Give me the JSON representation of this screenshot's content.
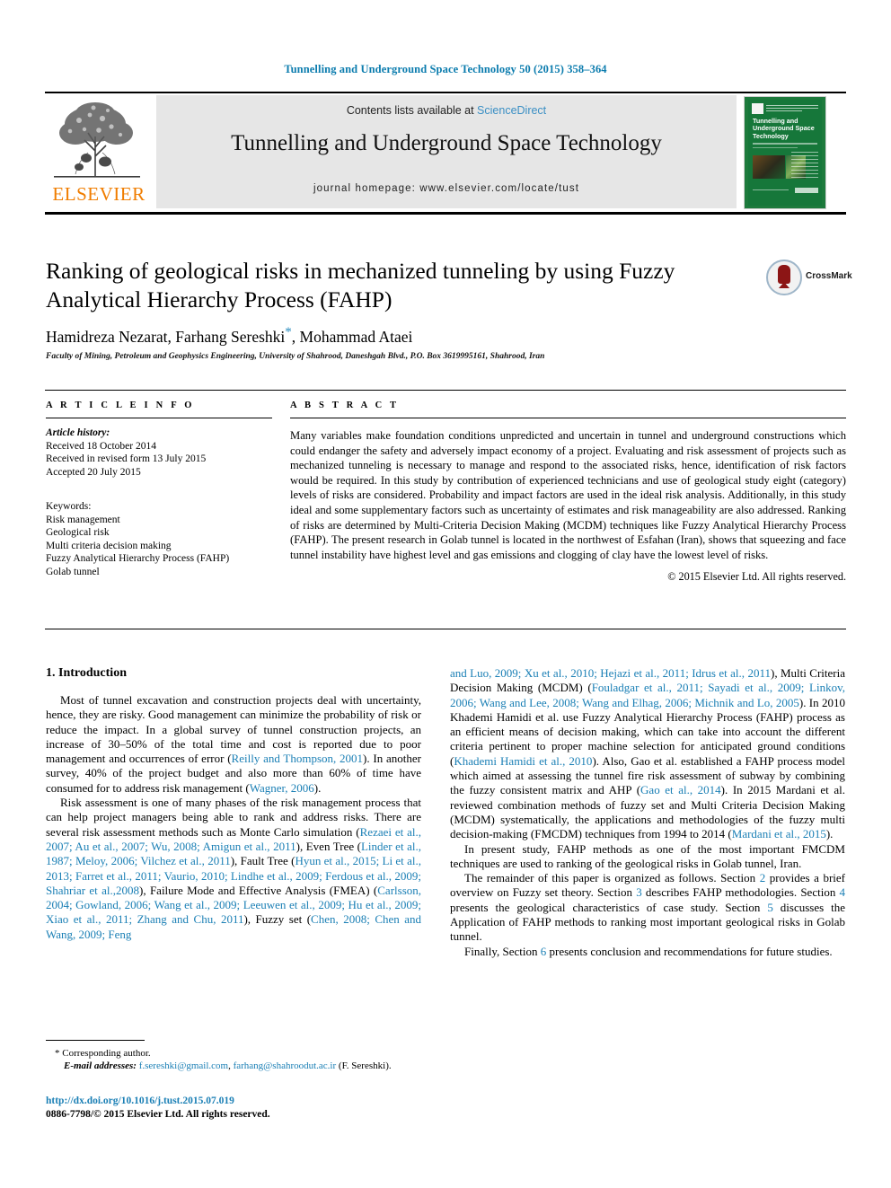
{
  "running_head": "Tunnelling and Underground Space Technology 50 (2015) 358–364",
  "masthead": {
    "contents_prefix": "Contents lists available at ",
    "sciencedirect": "ScienceDirect",
    "journal_title": "Tunnelling and Underground Space Technology",
    "homepage": "journal homepage: www.elsevier.com/locate/tust",
    "publisher_wordmark": "ELSEVIER",
    "cover": {
      "title": "Tunnelling and Underground Space Technology"
    }
  },
  "article": {
    "title": "Ranking of geological risks in mechanized tunneling by using Fuzzy Analytical Hierarchy Process (FAHP)",
    "authors_part1": "Hamidreza Nezarat, Farhang Sereshki",
    "corresponding_marker": "*",
    "authors_part2": ", Mohammad Ataei",
    "affiliation": "Faculty of Mining, Petroleum and Geophysics Engineering, University of Shahrood, Daneshgah Blvd., P.O. Box 3619995161, Shahrood, Iran",
    "crossmark_label": "CrossMark"
  },
  "article_info": {
    "heading": "A R T I C L E   I N F O",
    "history_label": "Article history:",
    "received": "Received 18 October 2014",
    "revised": "Received in revised form 13 July 2015",
    "accepted": "Accepted 20 July 2015",
    "keywords_label": "Keywords:",
    "keywords": [
      "Risk management",
      "Geological risk",
      "Multi criteria decision making",
      "Fuzzy Analytical Hierarchy Process (FAHP)",
      "Golab tunnel"
    ]
  },
  "abstract": {
    "heading": "A B S T R A C T",
    "text": "Many variables make foundation conditions unpredicted and uncertain in tunnel and underground constructions which could endanger the safety and adversely impact economy of a project. Evaluating and risk assessment of projects such as mechanized tunneling is necessary to manage and respond to the associated risks, hence, identification of risk factors would be required. In this study by contribution of experienced technicians and use of geological study eight (category) levels of risks are considered. Probability and impact factors are used in the ideal risk analysis. Additionally, in this study ideal and some supplementary factors such as uncertainty of estimates and risk manageability are also addressed. Ranking of risks are determined by Multi-Criteria Decision Making (MCDM) techniques like Fuzzy Analytical Hierarchy Process (FAHP). The present research in Golab tunnel is located in the northwest of Esfahan (Iran), shows that squeezing and face tunnel instability have highest level and gas emissions and clogging of clay have the lowest level of risks.",
    "copyright": "© 2015 Elsevier Ltd. All rights reserved."
  },
  "body": {
    "section_heading": "1. Introduction",
    "left": {
      "p1_a": "Most of tunnel excavation and construction projects deal with uncertainty, hence, they are risky. Good management can minimize the probability of risk or reduce the impact. In a global survey of tunnel construction projects, an increase of 30–50% of the total time and cost is reported due to poor management and occurrences of error (",
      "p1_cite1": "Reilly and Thompson, 2001",
      "p1_b": "). In another survey, 40% of the project budget and also more than 60% of time have consumed for to address risk management (",
      "p1_cite2": "Wagner, 2006",
      "p1_c": ").",
      "p2_a": "Risk assessment is one of many phases of the risk management process that can help project managers being able to rank and address risks. There are several risk assessment methods such as Monte Carlo simulation (",
      "p2_cite1": "Rezaei et al., 2007; Au et al., 2007; Wu, 2008; Amigun et al., 2011",
      "p2_b": "), Even Tree (",
      "p2_cite2": "Linder et al., 1987; Meloy, 2006; Vilchez et al., 2011",
      "p2_c": "), Fault Tree (",
      "p2_cite3": "Hyun et al., 2015; Li et al., 2013; Farret et al., 2011; Vaurio, 2010; Lindhe et al., 2009; Ferdous et al., 2009; Shahriar et al.,2008",
      "p2_d": "), Failure Mode and Effective Analysis (FMEA) (",
      "p2_cite4": "Carlsson, 2004; Gowland, 2006; Wang et al., 2009; Leeuwen et al., 2009; Hu et al., 2009; Xiao et al., 2011; Zhang and Chu, 2011",
      "p2_e": "), Fuzzy set (",
      "p2_cite5": "Chen, 2008; Chen and Wang, 2009; Feng"
    },
    "right": {
      "p2_cont_cite": "and Luo, 2009; Xu et al., 2010; Hejazi et al., 2011; Idrus et al., 2011",
      "p2_cont_a": "), Multi Criteria Decision Making (MCDM) (",
      "p2_cont_cite2": "Fouladgar et al., 2011; Sayadi et al., 2009; Linkov, 2006; Wang and Lee, 2008; Wang and Elhag, 2006; Michnik and Lo, 2005",
      "p2_cont_b": "). In 2010 Khademi Hamidi et al. use Fuzzy Analytical Hierarchy Process (FAHP) process as an efficient means of decision making, which can take into account the different criteria pertinent to proper machine selection for anticipated ground conditions (",
      "p2_cont_cite3": "Khademi Hamidi et al., 2010",
      "p2_cont_c": "). Also, Gao et al. established a FAHP process model which aimed at assessing the tunnel fire risk assessment of subway by combining the fuzzy consistent matrix and AHP (",
      "p2_cont_cite4": "Gao et al., 2014",
      "p2_cont_d": "). In 2015 Mardani et al. reviewed combination methods of fuzzy set and Multi Criteria Decision Making (MCDM) systematically, the applications and methodologies of the fuzzy multi decision-making (FMCDM) techniques from 1994 to 2014 (",
      "p2_cont_cite5": "Mardani et al., 2015",
      "p2_cont_e": ").",
      "p3": "In present study, FAHP methods as one of the most important FMCDM techniques are used to ranking of the geological risks in Golab tunnel, Iran.",
      "p4_a": "The remainder of this paper is organized as follows. Section ",
      "p4_s2": "2",
      "p4_b": " provides a brief overview on Fuzzy set theory. Section ",
      "p4_s3": "3",
      "p4_c": " describes FAHP methodologies. Section ",
      "p4_s4": "4",
      "p4_d": " presents the geological characteristics of case study. Section ",
      "p4_s5": "5",
      "p4_e": " discusses the Application of FAHP methods to ranking most important geological risks in Golab tunnel.",
      "p5_a": "Finally, Section ",
      "p5_s6": "6",
      "p5_b": " presents conclusion and recommendations for future studies."
    }
  },
  "footnotes": {
    "corresponding": "* Corresponding author.",
    "email_label": "E-mail addresses:",
    "email1": "f.sereshki@gmail.com",
    "email_sep": ", ",
    "email2": "farhang@shahroodut.ac.ir",
    "email_suffix": " (F. Sereshki).",
    "doi": "http://dx.doi.org/10.1016/j.tust.2015.07.019",
    "issn_line": "0886-7798/© 2015 Elsevier Ltd. All rights reserved."
  },
  "colors": {
    "link_blue": "#1a7fb5",
    "header_blue": "#0b7cae",
    "elsevier_orange": "#f07d00",
    "cover_green": "#16773a"
  }
}
